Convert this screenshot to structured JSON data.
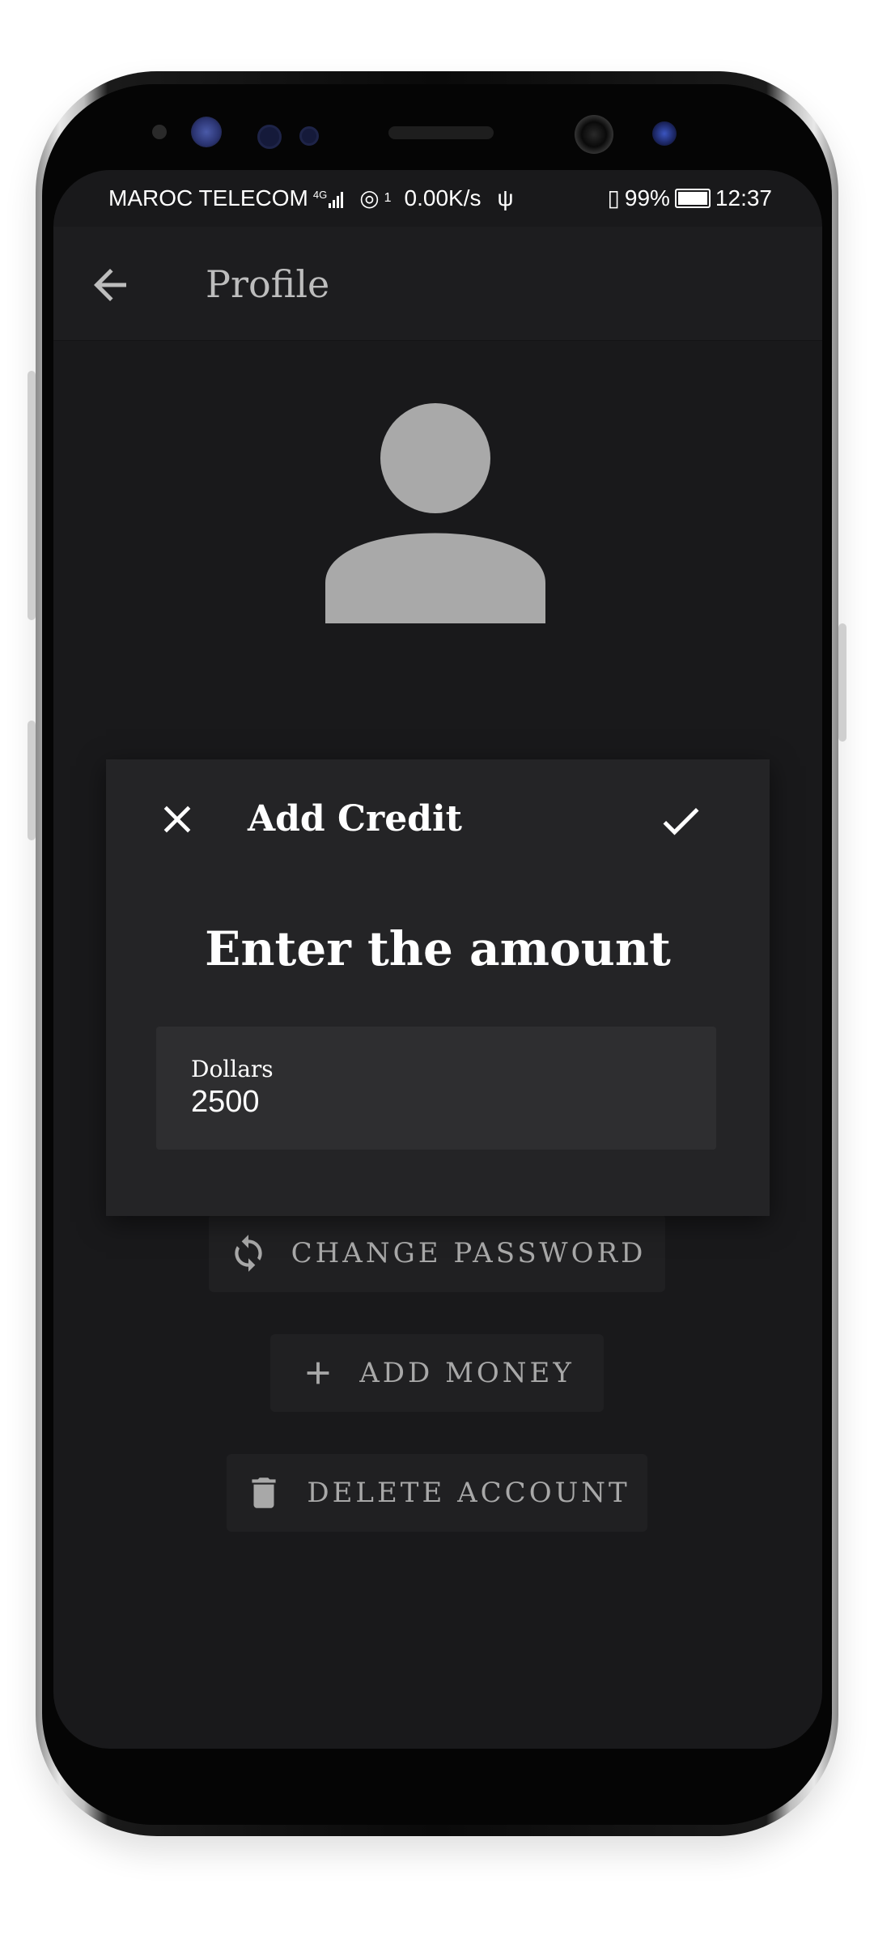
{
  "status_bar": {
    "carrier": "MAROC TELECOM",
    "network_type": "4G",
    "hotspot_count": "1",
    "net_speed": "0.00K/s",
    "battery": "99%",
    "time": "12:37",
    "icons": [
      "signal-icon",
      "hotspot-icon",
      "usb-icon",
      "vibrate-icon",
      "battery-charging-icon"
    ]
  },
  "app_bar": {
    "title": "Profile",
    "back_icon": "arrow-back-icon"
  },
  "avatar": {
    "icon": "person-icon"
  },
  "actions": {
    "change_password": "CHANGE PASSWORD",
    "add_money": "ADD MONEY",
    "delete_account": "DELETE ACCOUNT",
    "icons": [
      "refresh-icon",
      "plus-icon",
      "trash-icon"
    ]
  },
  "dialog": {
    "title": "Add Credit",
    "heading": "Enter the amount",
    "field_label": "Dollars",
    "field_value": "2500",
    "close_icon": "close-icon",
    "confirm_icon": "check-icon"
  },
  "colors": {
    "screen_bg": "#19191b",
    "app_bar_bg": "#1d1d1f",
    "dialog_bg": "#242426",
    "field_bg": "#2e2e30",
    "muted_text": "#a8a8a8",
    "avatar": "#a9a9a9"
  }
}
